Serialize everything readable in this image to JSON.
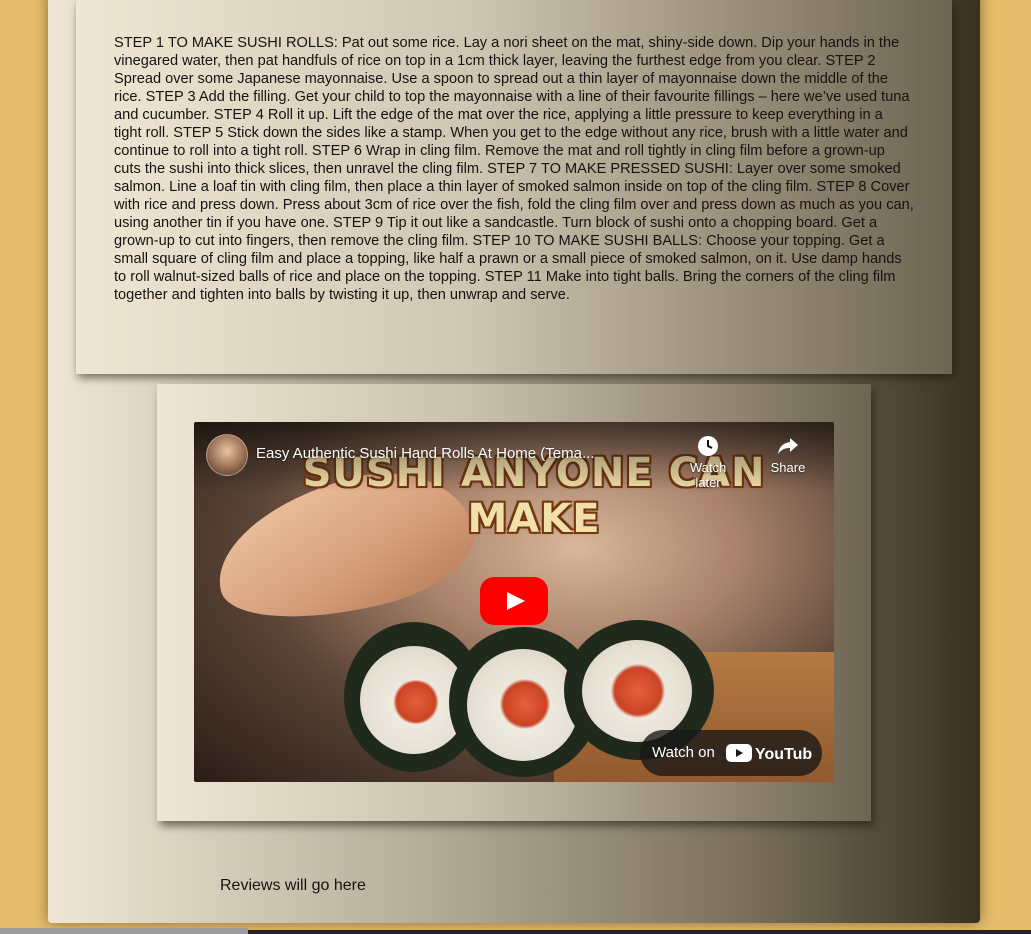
{
  "instructions": {
    "text": "STEP 1 TO MAKE SUSHI ROLLS: Pat out some rice. Lay a nori sheet on the mat, shiny-side down. Dip your hands in the vinegared water, then pat handfuls of rice on top in a 1cm thick layer, leaving the furthest edge from you clear. STEP 2 Spread over some Japanese mayonnaise. Use a spoon to spread out a thin layer of mayonnaise down the middle of the rice. STEP 3 Add the filling. Get your child to top the mayonnaise with a line of their favourite fillings – here we’ve used tuna and cucumber. STEP 4 Roll it up. Lift the edge of the mat over the rice, applying a little pressure to keep everything in a tight roll. STEP 5 Stick down the sides like a stamp. When you get to the edge without any rice, brush with a little water and continue to roll into a tight roll. STEP 6 Wrap in cling film. Remove the mat and roll tightly in cling film before a grown-up cuts the sushi into thick slices, then unravel the cling film. STEP 7 TO MAKE PRESSED SUSHI: Layer over some smoked salmon. Line a loaf tin with cling film, then place a thin layer of smoked salmon inside on top of the cling film. STEP 8 Cover with rice and press down. Press about 3cm of rice over the fish, fold the cling film over and press down as much as you can, using another tin if you have one. STEP 9 Tip it out like a sandcastle. Turn block of sushi onto a chopping board. Get a grown-up to cut into fingers, then remove the cling film. STEP 10 TO MAKE SUSHI BALLS: Choose your topping. Get a small square of cling film and place a topping, like half a prawn or a small piece of smoked salmon, on it. Use damp hands to roll walnut-sized balls of rice and place on the topping. STEP 11 Make into tight balls. Bring the corners of the cling film together and tighten into balls by twisting it up, then unwrap and serve."
  },
  "video": {
    "title": "Easy Authentic Sushi Hand Rolls At Home (Tema...",
    "thumbnail_banner": "SUSHI ANYONE CAN MAKE",
    "watch_later_label": "Watch later",
    "share_label": "Share",
    "watch_on_label": "Watch on",
    "youtube_wordmark": "YouTube",
    "icons": {
      "avatar": "channel-avatar",
      "watch_later": "clock-icon",
      "share": "share-arrow-icon",
      "play": "play-icon",
      "logo": "youtube-logo-icon"
    }
  },
  "reviews": {
    "placeholder_text": "Reviews will go here"
  },
  "colors": {
    "page_background": "#e6bd6c",
    "youtube_red": "#ff0000"
  }
}
